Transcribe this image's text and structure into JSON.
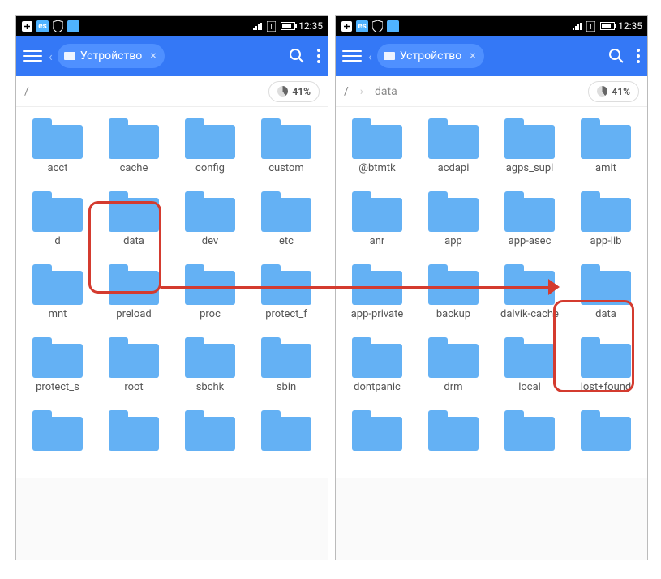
{
  "statusbar": {
    "time": "12:35"
  },
  "topbar": {
    "chip_label": "Устройство"
  },
  "storage": {
    "percent": "41%"
  },
  "left": {
    "breadcrumb": [
      "/"
    ],
    "folders": [
      "acct",
      "cache",
      "config",
      "custom",
      "d",
      "data",
      "dev",
      "etc",
      "mnt",
      "preload",
      "proc",
      "protect_f",
      "protect_s",
      "root",
      "sbchk",
      "sbin",
      "",
      "",
      "",
      ""
    ]
  },
  "right": {
    "breadcrumb": [
      "/",
      "data"
    ],
    "folders": [
      "@btmtk",
      "acdapi",
      "agps_supl",
      "amit",
      "anr",
      "app",
      "app-asec",
      "app-lib",
      "app-private",
      "backup",
      "dalvik-cache",
      "data",
      "dontpanic",
      "drm",
      "local",
      "lost+found",
      "",
      "",
      "",
      ""
    ]
  }
}
